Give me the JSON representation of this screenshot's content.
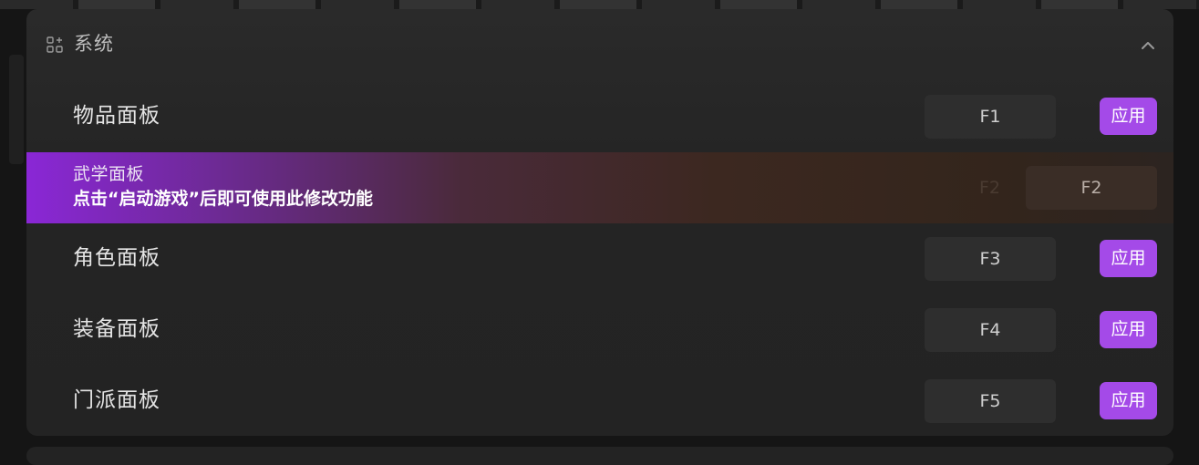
{
  "section": {
    "title": "系统"
  },
  "rows": [
    {
      "label": "物品面板",
      "key": "F1",
      "apply_label": "应用"
    },
    {
      "label": "武学面板",
      "key": "F2",
      "ghost_key": "F2",
      "note": "点击“启动游戏”后即可使用此修改功能"
    },
    {
      "label": "角色面板",
      "key": "F3",
      "apply_label": "应用"
    },
    {
      "label": "装备面板",
      "key": "F4",
      "apply_label": "应用"
    },
    {
      "label": "门派面板",
      "key": "F5",
      "apply_label": "应用"
    }
  ],
  "colors": {
    "accent": "#a44ae8",
    "panel": "#242424",
    "key_box": "#2e2e2e"
  },
  "icons": {
    "section": "grid-plus-icon",
    "collapse": "chevron-up-icon"
  }
}
